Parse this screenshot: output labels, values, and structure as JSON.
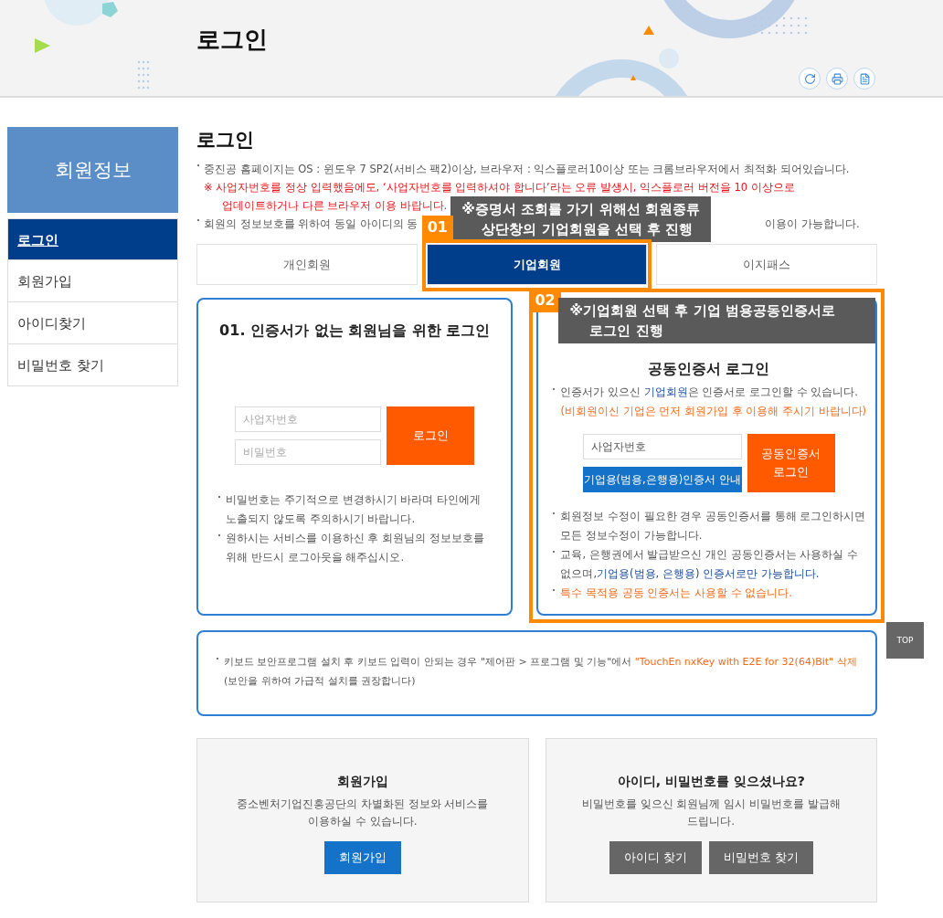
{
  "header": {
    "title": "로그인"
  },
  "sidebar": {
    "title": "회원정보",
    "items": [
      {
        "label": "로그인",
        "selected": true
      },
      {
        "label": "회원가입",
        "selected": false
      },
      {
        "label": "아이디찾기",
        "selected": false
      },
      {
        "label": "비밀번호 찾기",
        "selected": false
      }
    ]
  },
  "page_title": "로그인",
  "notices": [
    {
      "kind": "plain",
      "segments": [
        {
          "text": "중진공 홈페이지는 OS : 윈도우 7 SP2(서비스 팩2)이상, 브라우저 : 익스플로러10이상 또는 크롬브라우저에서 최적화 되어있습니다."
        }
      ]
    },
    {
      "kind": "alert",
      "segments": [
        {
          "text": "※ 사업자번호를 정상 입력했음에도, ‘사업자번호를 입력하셔야 합니다’라는 오류 발생시, 익스플로러 버전을 10 이상으로"
        },
        {
          "text": "업데이트하거나 다른 브라우저 이용 바랍니다."
        }
      ]
    },
    {
      "kind": "split",
      "segments": [
        {
          "text": "회원의 정보보호를 위하여 동일 아이디의 동"
        },
        {
          "text": "이용이 가능합니다."
        }
      ]
    }
  ],
  "annotations": [
    {
      "number": "01",
      "lines": [
        "※증명서 조회를 가기 위해선 회원종류",
        "상단창의 기업회원을 선택 후 진행"
      ]
    },
    {
      "number": "02",
      "lines": [
        "※기업회원 선택 후 기업 범용공동인증서로",
        "로그인 진행"
      ]
    }
  ],
  "tabs": [
    {
      "label": "개인회원",
      "selected": false
    },
    {
      "label": "기업회원",
      "selected": true
    },
    {
      "label": "이지패스",
      "selected": false
    }
  ],
  "basic_login": {
    "title": "01. 인증서가 없는 회원님을 위한 로그인",
    "fields": [
      {
        "placeholder": "사업자번호"
      },
      {
        "placeholder": "비밀번호"
      }
    ],
    "button": "로그인",
    "notes": [
      "비밀번호는 주기적으로 변경하시기 바라며 타인에게 노출되지 않도록 주의하시기 바랍니다.",
      "원하시는 서비스를 이용하신 후 회원님의 정보보호를 위해 반드시 로그아웃을 해주십시오."
    ]
  },
  "cert_login": {
    "title": "공동인증서 로그인",
    "intro": [
      {
        "segments": [
          {
            "text": "인증서가 있으신 ",
            "kind": "plain"
          },
          {
            "text": "기업회원",
            "kind": "link"
          },
          {
            "text": "은 인증서로 로그인할 수 있습니다.",
            "kind": "plain"
          }
        ],
        "bullet": true
      },
      {
        "segments": [
          {
            "text": "(비회원이신 기업은 먼저 회원가입 후 이용해 주시기 바랍니다)",
            "kind": "warning"
          }
        ],
        "bullet": false
      }
    ],
    "field": {
      "placeholder": "사업자번호"
    },
    "guide_button": "기업용(범용,은행용)인증서 안내",
    "button": "공동인증서 로그인",
    "notes": [
      {
        "segments": [
          {
            "text": "회원정보 수정이 필요한 경우 공동인증서를 통해 로그인하시면 모든 정보수정이 가능합니다.",
            "kind": "plain"
          }
        ]
      },
      {
        "segments": [
          {
            "text": "교육, 은행권에서 발급받으신 개인 공동인증서는 사용하실 수 없으며,",
            "kind": "plain"
          },
          {
            "text": "기업용(범용, 은행용) 인증서로만 가능합니다.",
            "kind": "link"
          }
        ]
      },
      {
        "segments": [
          {
            "text": "특수 목적용 공동 인증서는 사용할 수 없습니다.",
            "kind": "warning"
          }
        ]
      }
    ]
  },
  "keyboard_notice": {
    "segments": [
      {
        "text": "키보드 보안프로그램 설치 후 키보드 입력이 안되는 경우 \"제어판 > 프로그램 및 기능\"에서 ",
        "kind": "plain"
      },
      {
        "text": "\"TouchEn nxKey with E2E for 32(64)Bit\" 삭제",
        "kind": "warning"
      }
    ],
    "second_line": "(보안을 위하여 가급적 설치를 권장합니다)"
  },
  "help_boxes": [
    {
      "title": "회원가입",
      "description": "중소벤처기업진흥공단의 차별화된 정보와 서비스를 이용하실 수 있습니다.",
      "buttons": [
        {
          "label": "회원가입",
          "kind": "primary"
        }
      ]
    },
    {
      "title": "아이디, 비밀번호를 잊으셨나요?",
      "description": "비밀번호를 잊으신 회원님께 임시 비밀번호를 발급해 드립니다.",
      "buttons": [
        {
          "label": "아이디 찾기",
          "kind": "secondary"
        },
        {
          "label": "비밀번호 찾기",
          "kind": "secondary"
        }
      ]
    }
  ],
  "top_button": "TOP"
}
